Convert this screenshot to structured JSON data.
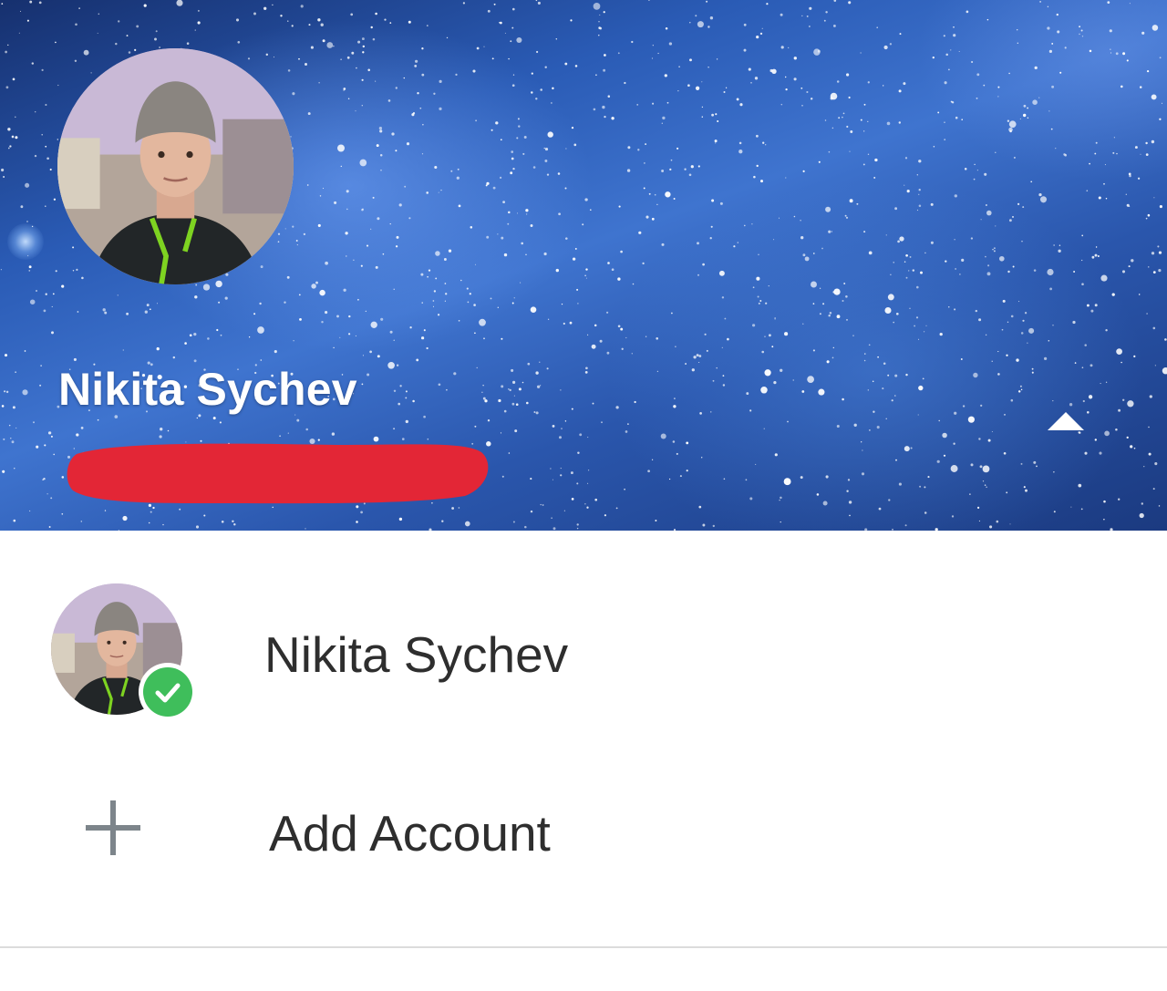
{
  "header": {
    "account_name": "Nikita Sychev",
    "background": "starfield",
    "expand_icon": "triangle-up-icon",
    "redaction_color": "#e32636"
  },
  "accounts": [
    {
      "name": "Nikita Sychev",
      "active": true,
      "badge_icon": "checkmark-icon",
      "badge_color": "#3fbe5b"
    }
  ],
  "add_account": {
    "label": "Add Account",
    "icon": "plus-icon"
  }
}
